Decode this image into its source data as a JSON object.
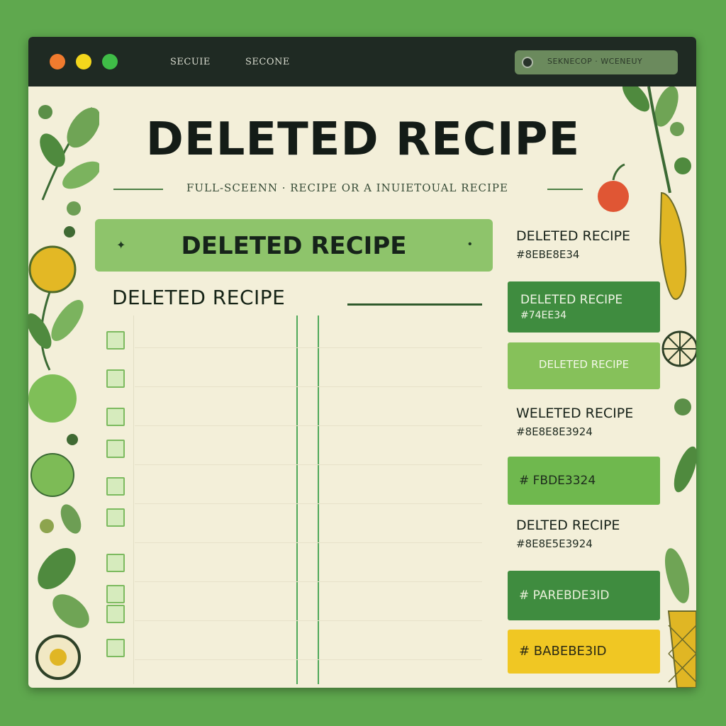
{
  "window": {
    "tabs": [
      "SECUIE",
      "SECONE"
    ],
    "address_text": "SEKNECOP · WCENEUY"
  },
  "header": {
    "title": "DELETED RECIPE",
    "subtitle": "FULL-SCEENN · RECIPE OR A INUIETOUAL RECIPE"
  },
  "banner": {
    "label": "DELETED RECIPE",
    "left_arrow": "✦",
    "right_arrow": "•"
  },
  "section": {
    "title": "DELETED RECIPE"
  },
  "checklist": {
    "rows": 10
  },
  "sidebar": {
    "item1": {
      "title": "DELETED RECIPE",
      "code": "#8EBE8E34"
    },
    "btn1": {
      "title": "DELETED RECIPE",
      "code": "#74EE34"
    },
    "btn2": {
      "label": "DELETED RECIPE"
    },
    "item2": {
      "title": "WELETED RECIPE",
      "code": "#8E8E8E3924"
    },
    "btn3": {
      "label": "# FBDE3324"
    },
    "item3": {
      "title": "DELTED RECIPE",
      "code": "#8E8E5E3924"
    },
    "btn4": {
      "label": "# PAREBDE3ID"
    },
    "btn5": {
      "label": "# BABEBE3ID"
    }
  },
  "colors": {
    "background": "#5fa84e",
    "titlebar": "#1f2a23",
    "paper": "#f3efd9",
    "banner": "#8ec46b",
    "btn_dark_green": "#3f8c3f",
    "btn_light_green": "#86c15a",
    "btn_mid_green": "#6fb84e",
    "btn_yellow": "#f0c723"
  }
}
